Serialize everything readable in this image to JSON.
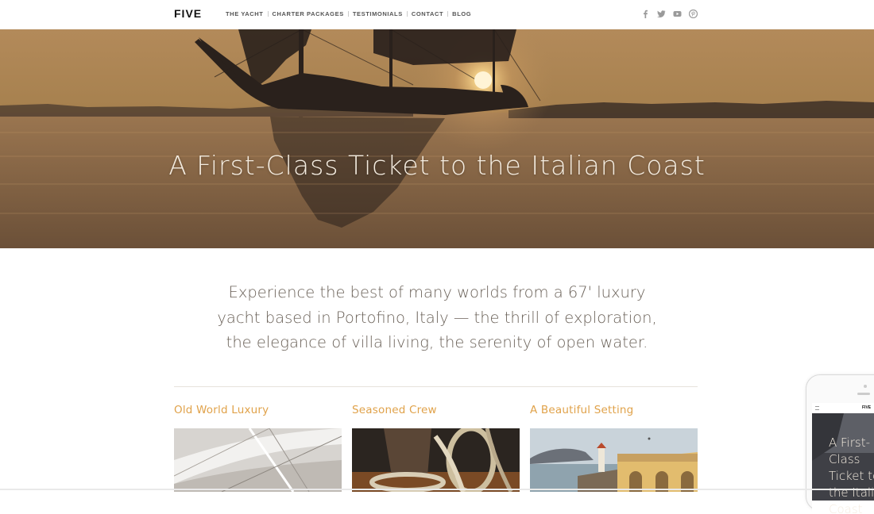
{
  "header": {
    "logo": "FIVE",
    "nav": [
      {
        "label": "THE YACHT"
      },
      {
        "label": "CHARTER PACKAGES"
      },
      {
        "label": "TESTIMONIALS"
      },
      {
        "label": "CONTACT"
      },
      {
        "label": "BLOG"
      }
    ],
    "social": [
      "facebook-icon",
      "twitter-icon",
      "youtube-icon",
      "pinterest-icon"
    ]
  },
  "hero": {
    "title": "A First-Class Ticket to the Italian Coast"
  },
  "intro": {
    "text": "Experience the best of many worlds from a 67' luxury yacht based in Portofino, Italy — the thrill of exploration, the elegance of villa living, the serenity of open water."
  },
  "features": [
    {
      "title": "Old World Luxury"
    },
    {
      "title": "Seasoned Crew"
    },
    {
      "title": "A Beautiful Setting"
    }
  ],
  "phone_preview": {
    "logo": "FIVE",
    "title": "A First-Class Ticket to the Italian Coast"
  },
  "colors": {
    "accent": "#e0a24a",
    "hero_tint": "#a5794a",
    "body_text": "#6a6158"
  }
}
